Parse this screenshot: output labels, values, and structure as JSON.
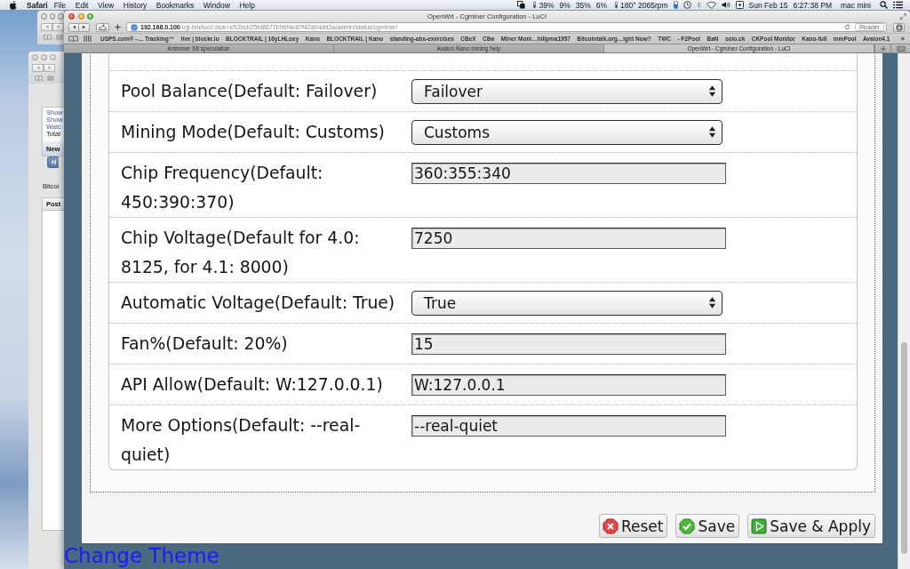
{
  "menu_bar": {
    "app": "Safari",
    "menus": [
      "File",
      "Edit",
      "View",
      "History",
      "Bookmarks",
      "Window",
      "Help"
    ],
    "status_items": [
      {
        "kind": "sensor",
        "text": "39%"
      },
      {
        "kind": "plain",
        "text": "9%"
      },
      {
        "kind": "plain",
        "text": "35%"
      },
      {
        "kind": "plain",
        "text": "6%"
      },
      {
        "kind": "sensor",
        "text": "180° 2065rpm"
      }
    ],
    "date": "Sun Feb 15",
    "time": "6:27:38 PM",
    "user": "mac mini"
  },
  "background_window": {
    "items": [
      {
        "kind": "link",
        "text": "Show"
      },
      {
        "kind": "link",
        "text": "Show"
      },
      {
        "kind": "link",
        "text": "Watc"
      },
      {
        "kind": "plain",
        "text": "Total"
      }
    ],
    "section": "New",
    "tab": "H",
    "text": "Bitcoi",
    "column_header": "Post"
  },
  "browser": {
    "title": "OpenWrt - Cgminer Configuration - LuCI",
    "url": {
      "host": "192.168.0.100",
      "path": "/cgi-bin/luci/;stok=e52bcb25fd8677b96f4e87f42a04dd2a/admin/status/cgminer/"
    },
    "reader": {
      "label": "Reader",
      "disabled": true
    },
    "bookmarks": [
      "USPS.com® -… Tracking™",
      "live | blockr.io",
      "BLOCKTRAIL | 16yLHLoey",
      "Kano",
      "BLOCKTRAIL | Kano",
      "standing-abs-exercises",
      "CBeX",
      "C8w",
      "Miner Moni…hilipma1957",
      "Bitcointalk.org…ight Now?",
      "TWC",
      "- F2Pool",
      "BaN",
      "solo.ck",
      "CKPool Monitor",
      "Kano-full",
      "mmPool",
      "Avalon4.1"
    ],
    "bookmarks_more": "»",
    "tabs": [
      {
        "label": "Antminer S6 speculation",
        "selected": false
      },
      {
        "label": "Avalon Nano mining help",
        "selected": false
      },
      {
        "label": "OpenWrt - Cgminer Configuration - LuCI",
        "selected": true
      }
    ]
  },
  "form": {
    "rows": [
      {
        "label": "Pool Balance(Default: Failover)",
        "kind": "select",
        "value": "Failover"
      },
      {
        "label": "Mining Mode(Default: Customs)",
        "kind": "select",
        "value": "Customs"
      },
      {
        "label": "Chip Frequency(Default: 450:390:370)",
        "kind": "text",
        "value": "360:355:340"
      },
      {
        "label": "Chip Voltage(Default for 4.0: 8125, for 4.1: 8000)",
        "kind": "text",
        "value": "7250"
      },
      {
        "label": "Automatic Voltage(Default: True)",
        "kind": "select",
        "value": "True"
      },
      {
        "label": "Fan%(Default: 20%)",
        "kind": "text",
        "value": "15"
      },
      {
        "label": "API Allow(Default: W:127.0.0.1)",
        "kind": "text",
        "value": "W:127.0.0.1"
      },
      {
        "label": "More Options(Default: --real-quiet)",
        "kind": "text",
        "value": "--real-quiet"
      }
    ],
    "buttons": [
      {
        "kind": "reset",
        "label": "Reset"
      },
      {
        "kind": "save",
        "label": "Save"
      },
      {
        "kind": "apply",
        "label": "Save & Apply"
      }
    ]
  },
  "footer": {
    "link": "Change Theme"
  }
}
